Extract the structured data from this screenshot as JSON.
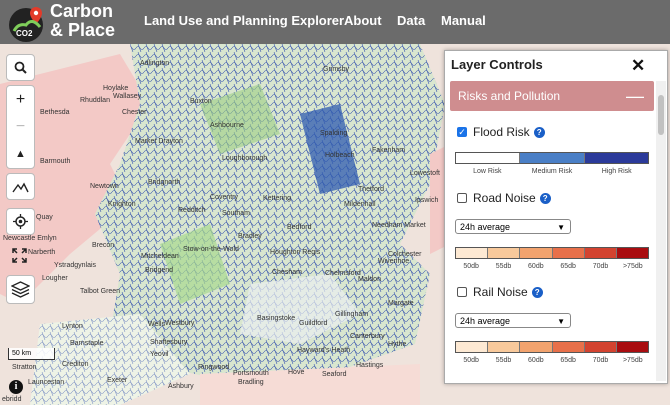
{
  "brand": {
    "line1": "Carbon",
    "line2": "& Place",
    "logo_text": "CO2"
  },
  "nav": [
    "Land Use and Planning Explorer",
    "About",
    "Data",
    "Manual"
  ],
  "map_labels": [
    "Grimsby",
    "Hoylake",
    "Wallasey",
    "Adlington",
    "Buxton",
    "Rhuddlan",
    "Bethesda",
    "Chester",
    "Ashbourne",
    "Spalding",
    "Fakenham",
    "Barmouth",
    "Market Drayton",
    "Loughborough",
    "Holbeach",
    "Newtown",
    "Bridgnorth",
    "Coventry",
    "Kettering",
    "Thetford",
    "Lowestoft",
    "Knighton",
    "Redditch",
    "Southam",
    "Mildenhall",
    "Ipswich",
    "Quay",
    "Newcastle Emlyn",
    "Brecon",
    "Stow-on-the-Wold",
    "Bradley",
    "Bedford",
    "Needham Market",
    "Ystradgynlais",
    "Narberth",
    "Mitcheldean",
    "Houghton Regis",
    "Colchester",
    "Lougher",
    "Talbot Green",
    "Bridgend",
    "Chesham",
    "Chelmsford",
    "Maldon",
    "Wivenhoe",
    "Gillingham",
    "Margate",
    "Wells",
    "Westbury",
    "Basingstoke",
    "Guildford",
    "Canterbury",
    "Hythe",
    "Lynton",
    "Crediton",
    "Yeovil",
    "Ringwood",
    "Hayward's Heath",
    "Seaford",
    "Portsmouth",
    "Shaftesbury",
    "Hastings",
    "Hove",
    "Exeter",
    "Barnstaple",
    "Bradling",
    "Stratton",
    "Ashbury",
    "Launceston"
  ],
  "scale_label": "50 km",
  "attribution": "ebridd",
  "panel": {
    "title": "Layer Controls",
    "section": "Risks and Pollution",
    "layers": [
      {
        "label": "Flood Risk",
        "checked": true,
        "legend_colors": [
          "#ffffff",
          "#4a7fc6",
          "#2b3a9a"
        ],
        "legend_labels": [
          "Low Risk",
          "Medium Risk",
          "High Risk"
        ]
      },
      {
        "label": "Road Noise",
        "checked": false,
        "select": "24h average",
        "legend_colors": [
          "#fde9d3",
          "#f8c99b",
          "#f2a36e",
          "#e8704a",
          "#d34330",
          "#a90d10"
        ],
        "legend_labels": [
          "50db",
          "55db",
          "60db",
          "65db",
          "70db",
          ">75db"
        ]
      },
      {
        "label": "Rail Noise",
        "checked": false,
        "select": "24h average",
        "legend_colors": [
          "#fde9d3",
          "#f8c99b",
          "#f2a36e",
          "#e8704a",
          "#d34330",
          "#a90d10"
        ],
        "legend_labels": [
          "50db",
          "55db",
          "60db",
          "65db",
          "70db",
          ">75db"
        ]
      }
    ]
  }
}
